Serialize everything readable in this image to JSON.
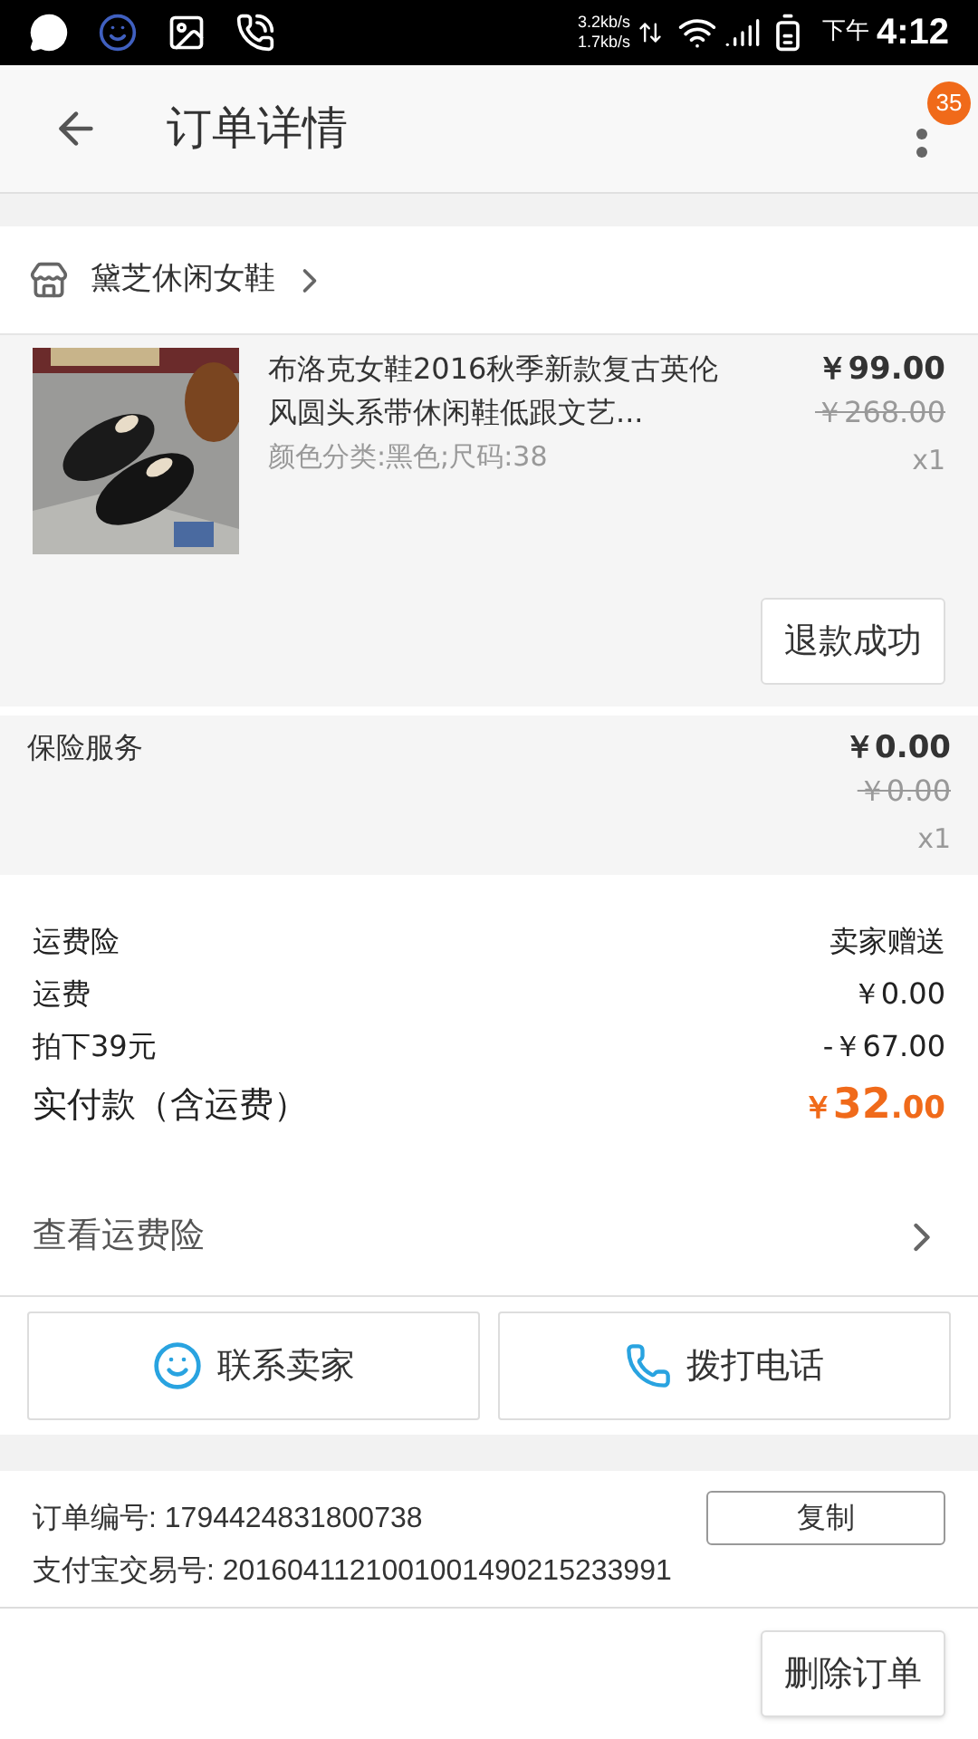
{
  "status_bar": {
    "net_up": "3.2kb/s",
    "net_down": "1.7kb/s",
    "time_period": "下午",
    "time": "4:12"
  },
  "header": {
    "title": "订单详情",
    "badge": "35"
  },
  "shop": {
    "name": "黛芝休闲女鞋"
  },
  "product": {
    "title": "布洛克女鞋2016秋季新款复古英伦风圆头系带休闲鞋低跟文艺...",
    "sku": "颜色分类:黑色;尺码:38",
    "price": "￥99.00",
    "original_price": "￥268.00",
    "quantity": "x1",
    "status_button": "退款成功"
  },
  "insurance": {
    "label": "保险服务",
    "price": "￥0.00",
    "original_price": "￥0.00",
    "quantity": "x1"
  },
  "fees": [
    {
      "label": "运费险",
      "value": "卖家赠送"
    },
    {
      "label": "运费",
      "value": "￥0.00"
    },
    {
      "label": "拍下39元",
      "value": "-￥67.00"
    }
  ],
  "total": {
    "label": "实付款（含运费）",
    "currency": "￥",
    "integer": "32",
    "decimal": ".00"
  },
  "link": {
    "label": "查看运费险"
  },
  "contact_buttons": [
    {
      "kind": "chat",
      "label": "联系卖家"
    },
    {
      "kind": "phone",
      "label": "拨打电话"
    }
  ],
  "order_info": [
    {
      "text": "订单编号: 1794424831800738"
    },
    {
      "text": "支付宝交易号: 2016041121001001490215233991"
    }
  ],
  "copy_button": "复制",
  "delete_button": "删除订单"
}
